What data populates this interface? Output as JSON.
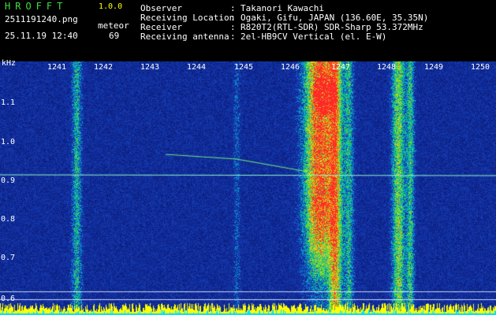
{
  "header": {
    "app_title": "HROFFT",
    "version": "1.0.0",
    "file_name": "2511191240.png",
    "date_time": "25.11.19 12:40",
    "type_label": "meteor",
    "count": "69"
  },
  "info": [
    {
      "label": "Observer",
      "value": "Takanori Kawachi"
    },
    {
      "label": "Receiving Location",
      "value": "Ogaki, Gifu, JAPAN (136.60E, 35.35N)"
    },
    {
      "label": "Receiver",
      "value": "R820T2(RTL-SDR) SDR-Sharp 53.372MHz"
    },
    {
      "label": "Receiving antenna",
      "value": "2el-HB9CV Vertical (el. E-W)"
    }
  ],
  "plot": {
    "y_unit": "kHz",
    "y_ticks": [
      "1.1",
      "1.0",
      "0.9",
      "0.8",
      "0.7",
      "0.6"
    ],
    "x_ticks": [
      "1241",
      "1242",
      "1243",
      "1244",
      "1245",
      "1246",
      "1247",
      "1248",
      "1249",
      "1250"
    ]
  },
  "colors": {
    "header_green": "#3fe03f",
    "header_white": "#ffffff",
    "background_blue": "#0a1a9a",
    "signal_hot": "#ff2020",
    "baseline_yellow": "#ffff00",
    "baseline_cyan": "#00e0ff"
  }
}
